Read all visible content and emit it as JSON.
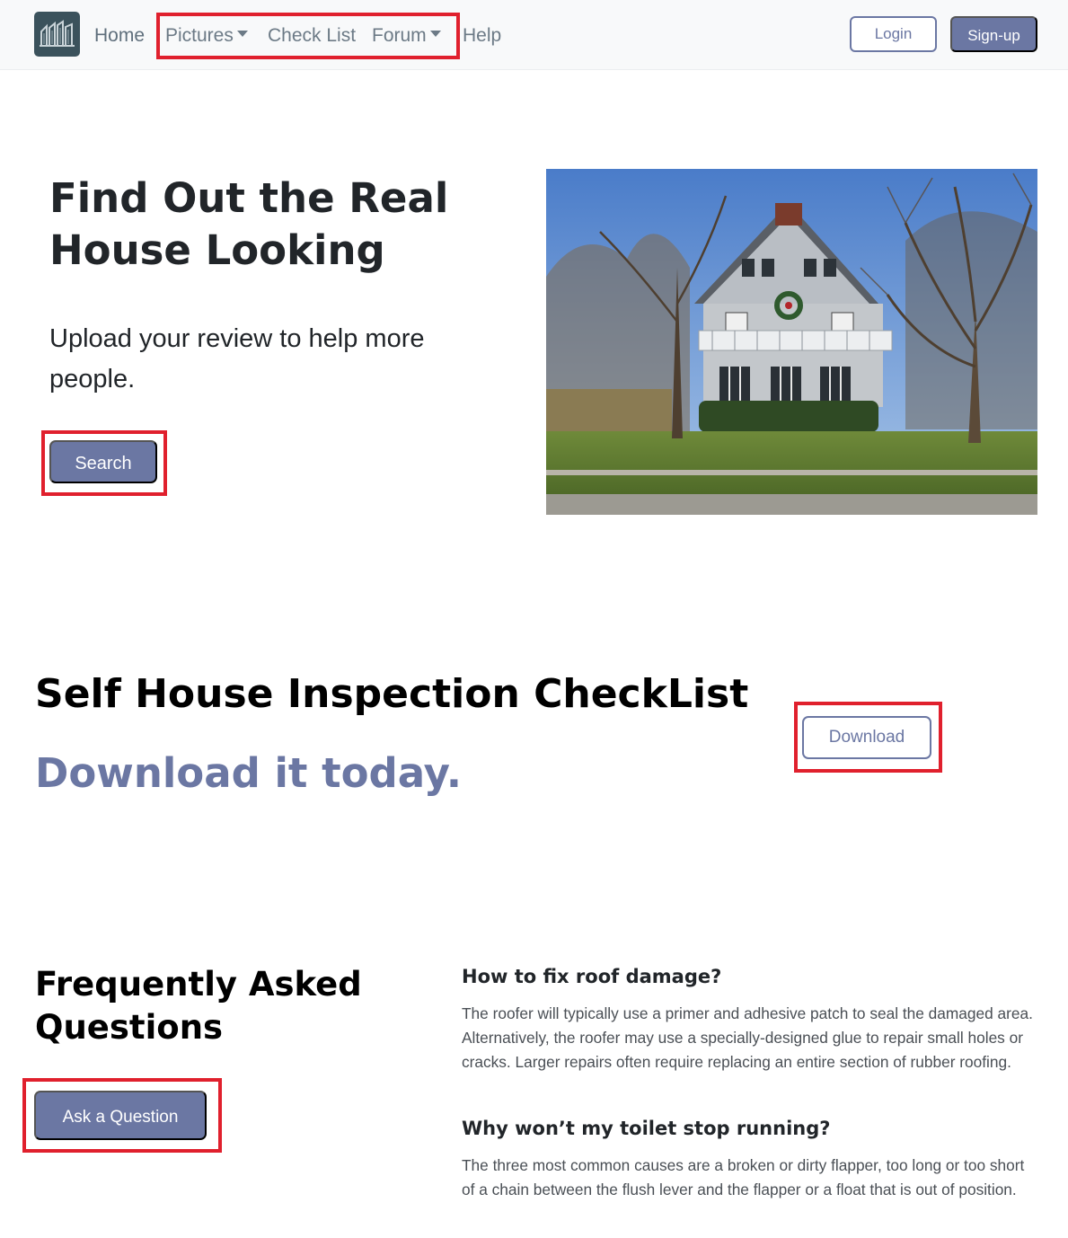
{
  "navbar": {
    "logo_icon": "building-logo-icon",
    "links": {
      "home": "Home",
      "pictures": "Pictures",
      "checklist": "Check List",
      "forum": "Forum",
      "help": "Help"
    },
    "login": "Login",
    "signup": "Sign-up"
  },
  "hero": {
    "title": "Find Out the Real House Looking",
    "lead": "Upload your review to help more people.",
    "search_button": "Search"
  },
  "checklist": {
    "title": "Self House Inspection CheckList",
    "subtitle": "Download it today.",
    "download_button": "Download"
  },
  "faq": {
    "title": "Frequently Asked Questions",
    "ask_button": "Ask a Question",
    "items": [
      {
        "question": "How to fix roof damage?",
        "answer": "The roofer will typically use a primer and adhesive patch to seal the damaged area. Alternatively, the roofer may use a specially-designed glue to repair small holes or cracks. Larger repairs often require replacing an entire section of rubber roofing."
      },
      {
        "question": "Why won’t my toilet stop running?",
        "answer": "The three most common causes are a broken or dirty flapper, too long or too short of a chain between the flush lever and the flapper or a float that is out of position."
      }
    ]
  },
  "colors": {
    "accent": "#6b77a3",
    "highlight": "#e0202d",
    "navbar_bg": "#f8f9fa",
    "logo_bg": "#3b525c"
  }
}
